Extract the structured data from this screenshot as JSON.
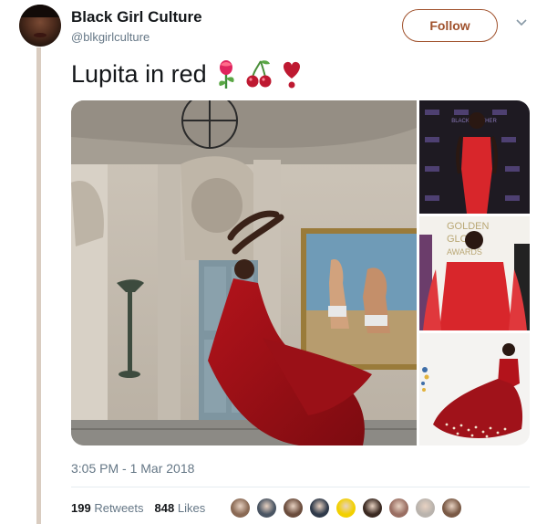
{
  "user": {
    "display_name": "Black Girl Culture",
    "handle": "@blkgirlculture"
  },
  "actions": {
    "follow_label": "Follow"
  },
  "tweet": {
    "text": "Lupita in red",
    "emojis": [
      "rose-emoji",
      "cherries-emoji",
      "heart-exclamation-emoji"
    ],
    "timestamp": "3:05 PM - 1 Mar 2018"
  },
  "media": {
    "side_photo_1": {
      "backdrop_text": "BLACK PANTHER"
    },
    "side_photo_2": {
      "backdrop_text_1": "GOLDEN",
      "backdrop_text_2": "GLOBE",
      "backdrop_text_3": "AWARDS"
    }
  },
  "stats": {
    "retweets_count": "199",
    "retweets_label": "Retweets",
    "likes_count": "848",
    "likes_label": "Likes"
  },
  "likers": [
    {
      "name": "liker-avatar-1",
      "color": "#8a6a55"
    },
    {
      "name": "liker-avatar-2",
      "color": "#4a5563"
    },
    {
      "name": "liker-avatar-3",
      "color": "#6b4d3d"
    },
    {
      "name": "liker-avatar-4",
      "color": "#2f3a4a"
    },
    {
      "name": "liker-avatar-5",
      "color": "#f2d000"
    },
    {
      "name": "liker-avatar-6",
      "color": "#3b2a22"
    },
    {
      "name": "liker-avatar-7",
      "color": "#9a6f63"
    },
    {
      "name": "liker-avatar-8",
      "color": "#b9b3ad"
    },
    {
      "name": "liker-avatar-9",
      "color": "#7a5a46"
    }
  ],
  "colors": {
    "accent": "#a0522d",
    "thread_line": "#d9ccc0",
    "dress_red": "#b3131b"
  }
}
